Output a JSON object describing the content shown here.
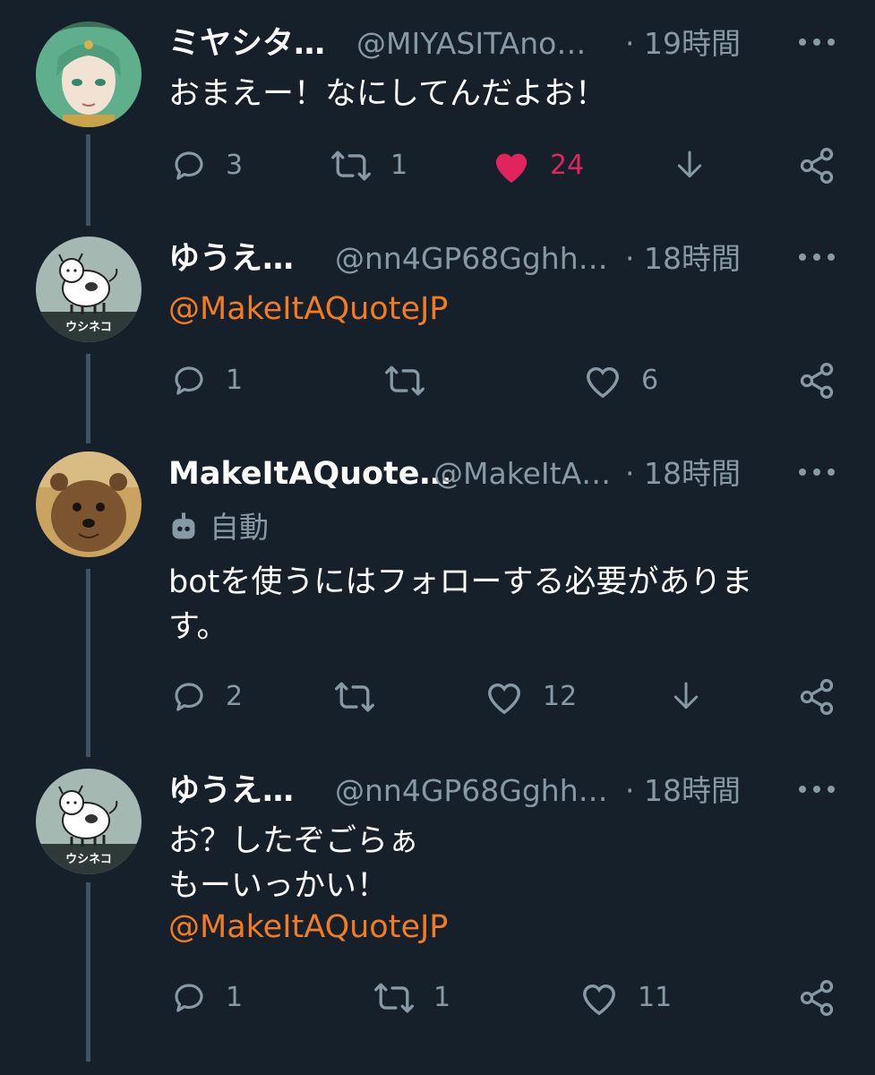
{
  "colors": {
    "background": "#15202b",
    "text_secondary": "#8899a6",
    "mention": "#f37c22",
    "like_active": "#e0245e",
    "thread_line": "#3d5466"
  },
  "tweets": [
    {
      "name": "ミヤシタ…",
      "handle": "@MIYASITAno…",
      "time": "· 19時間",
      "text": "おまえー！なにしてんだよお！",
      "reply_count": "3",
      "retweet_count": "1",
      "like_count": "24",
      "liked": true,
      "avatar_icon": "anime-character-avatar"
    },
    {
      "name": "ゆうえ…",
      "handle": "@nn4GP68Gghh…",
      "time": "· 18時間",
      "mention": "@MakeItAQuoteJP",
      "reply_count": "1",
      "retweet_count": "",
      "like_count": "6",
      "avatar_icon": "cow-cat-avatar",
      "avatar_caption": "ウシネコ"
    },
    {
      "name": "MakeItAQuote…",
      "handle": "@MakeItA…",
      "time": "· 18時間",
      "auto_label": "自動",
      "text": "botを使うにはフォローする必要がありま\nす。",
      "reply_count": "2",
      "retweet_count": "",
      "like_count": "12",
      "avatar_icon": "quokka-avatar"
    },
    {
      "name": "ゆうえ…",
      "handle": "@nn4GP68Gghh…",
      "time": "· 18時間",
      "text": "お？したぞごらぁ\nもーいっかい！",
      "mention": "@MakeItAQuoteJP",
      "reply_count": "1",
      "retweet_count": "1",
      "like_count": "11",
      "avatar_icon": "cow-cat-avatar",
      "avatar_caption": "ウシネコ"
    }
  ]
}
